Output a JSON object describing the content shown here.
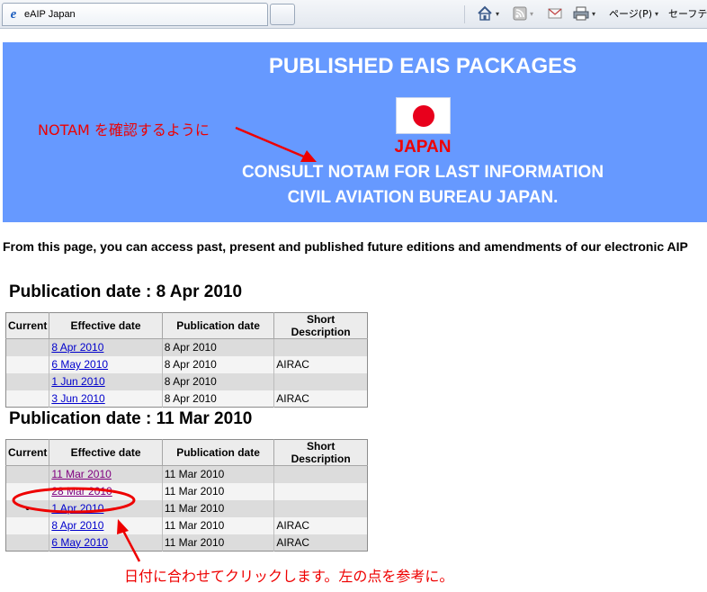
{
  "browser": {
    "tab_title": "eAIP  Japan",
    "toolbar": {
      "home_caret": "▾",
      "feeds_caret": "▾",
      "print_caret": "▾",
      "page_menu": "ページ(P)",
      "page_caret": "▾",
      "safety_menu": "セーフティ"
    }
  },
  "banner": {
    "title": "PUBLISHED EAIS PACKAGES",
    "country": "JAPAN",
    "consult": "CONSULT NOTAM FOR LAST INFORMATION",
    "bureau": "CIVIL AVIATION BUREAU JAPAN.",
    "annotation": "NOTAM を確認するように"
  },
  "intro": "From this page, you can access past, present and published future editions and amendments of our electronic AIP",
  "columns": [
    "Current",
    "Effective date",
    "Publication date",
    "Short Description"
  ],
  "sections": [
    {
      "heading": "Publication date : 8 Apr 2010",
      "rows": [
        {
          "current": "",
          "effective": "8 Apr 2010",
          "publication": "8 Apr 2010",
          "description": "",
          "visited": false
        },
        {
          "current": "",
          "effective": "6 May 2010",
          "publication": "8 Apr 2010",
          "description": "AIRAC",
          "visited": false
        },
        {
          "current": "",
          "effective": "1 Jun 2010",
          "publication": "8 Apr 2010",
          "description": "",
          "visited": false
        },
        {
          "current": "",
          "effective": "3 Jun 2010",
          "publication": "8 Apr 2010",
          "description": "AIRAC",
          "visited": false
        }
      ]
    },
    {
      "heading": "Publication date : 11 Mar 2010",
      "rows": [
        {
          "current": "",
          "effective": "11 Mar 2010",
          "publication": "11 Mar 2010",
          "description": "",
          "visited": true
        },
        {
          "current": "",
          "effective": "28 Mar 2010",
          "publication": "11 Mar 2010",
          "description": "",
          "visited": true
        },
        {
          "current": "•",
          "effective": "1 Apr 2010",
          "publication": "11 Mar 2010",
          "description": "",
          "visited": false
        },
        {
          "current": "",
          "effective": "8 Apr 2010",
          "publication": "11 Mar 2010",
          "description": "AIRAC",
          "visited": false
        },
        {
          "current": "",
          "effective": "6 May 2010",
          "publication": "11 Mar 2010",
          "description": "AIRAC",
          "visited": false
        }
      ]
    }
  ],
  "bottom_annotation": "日付に合わせてクリックします。左の点を参考に。",
  "colors": {
    "banner_bg": "#6699ff",
    "annotation_red": "#ee0000",
    "link": "#0000cc",
    "visited_link": "#800080"
  }
}
